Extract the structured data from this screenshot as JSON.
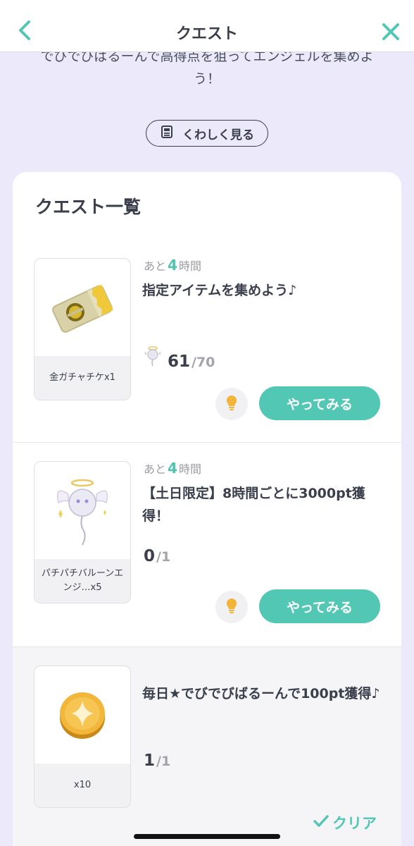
{
  "header": {
    "title": "クエスト"
  },
  "intro": {
    "text": "でびでびばるーんで高得点を狙ってエンジェルを集めよう！"
  },
  "detail_button": {
    "label": "くわしく見る"
  },
  "list": {
    "title": "クエスト一覧",
    "quests": [
      {
        "remain_prefix": "あと",
        "remain_number": "4",
        "remain_suffix": "時間",
        "title": "指定アイテムを集めよう♪",
        "reward_label": "金ガチャチケx1",
        "current": "61",
        "total": "/70",
        "action_label": "やってみる"
      },
      {
        "remain_prefix": "あと",
        "remain_number": "4",
        "remain_suffix": "時間",
        "title": "【土日限定】8時間ごとに3000pt獲得！",
        "reward_label": "パチパチバルーンエンジ…x5",
        "current": "0",
        "total": "/1",
        "action_label": "やってみる"
      },
      {
        "title": "毎日★でびでびばるーんで100pt獲得♪",
        "reward_label": "x10",
        "current": "1",
        "total": "/1",
        "status_label": "クリア"
      }
    ]
  },
  "colors": {
    "accent": "#52c7b3",
    "background": "#ece9fb",
    "text": "#3a3f4b"
  }
}
